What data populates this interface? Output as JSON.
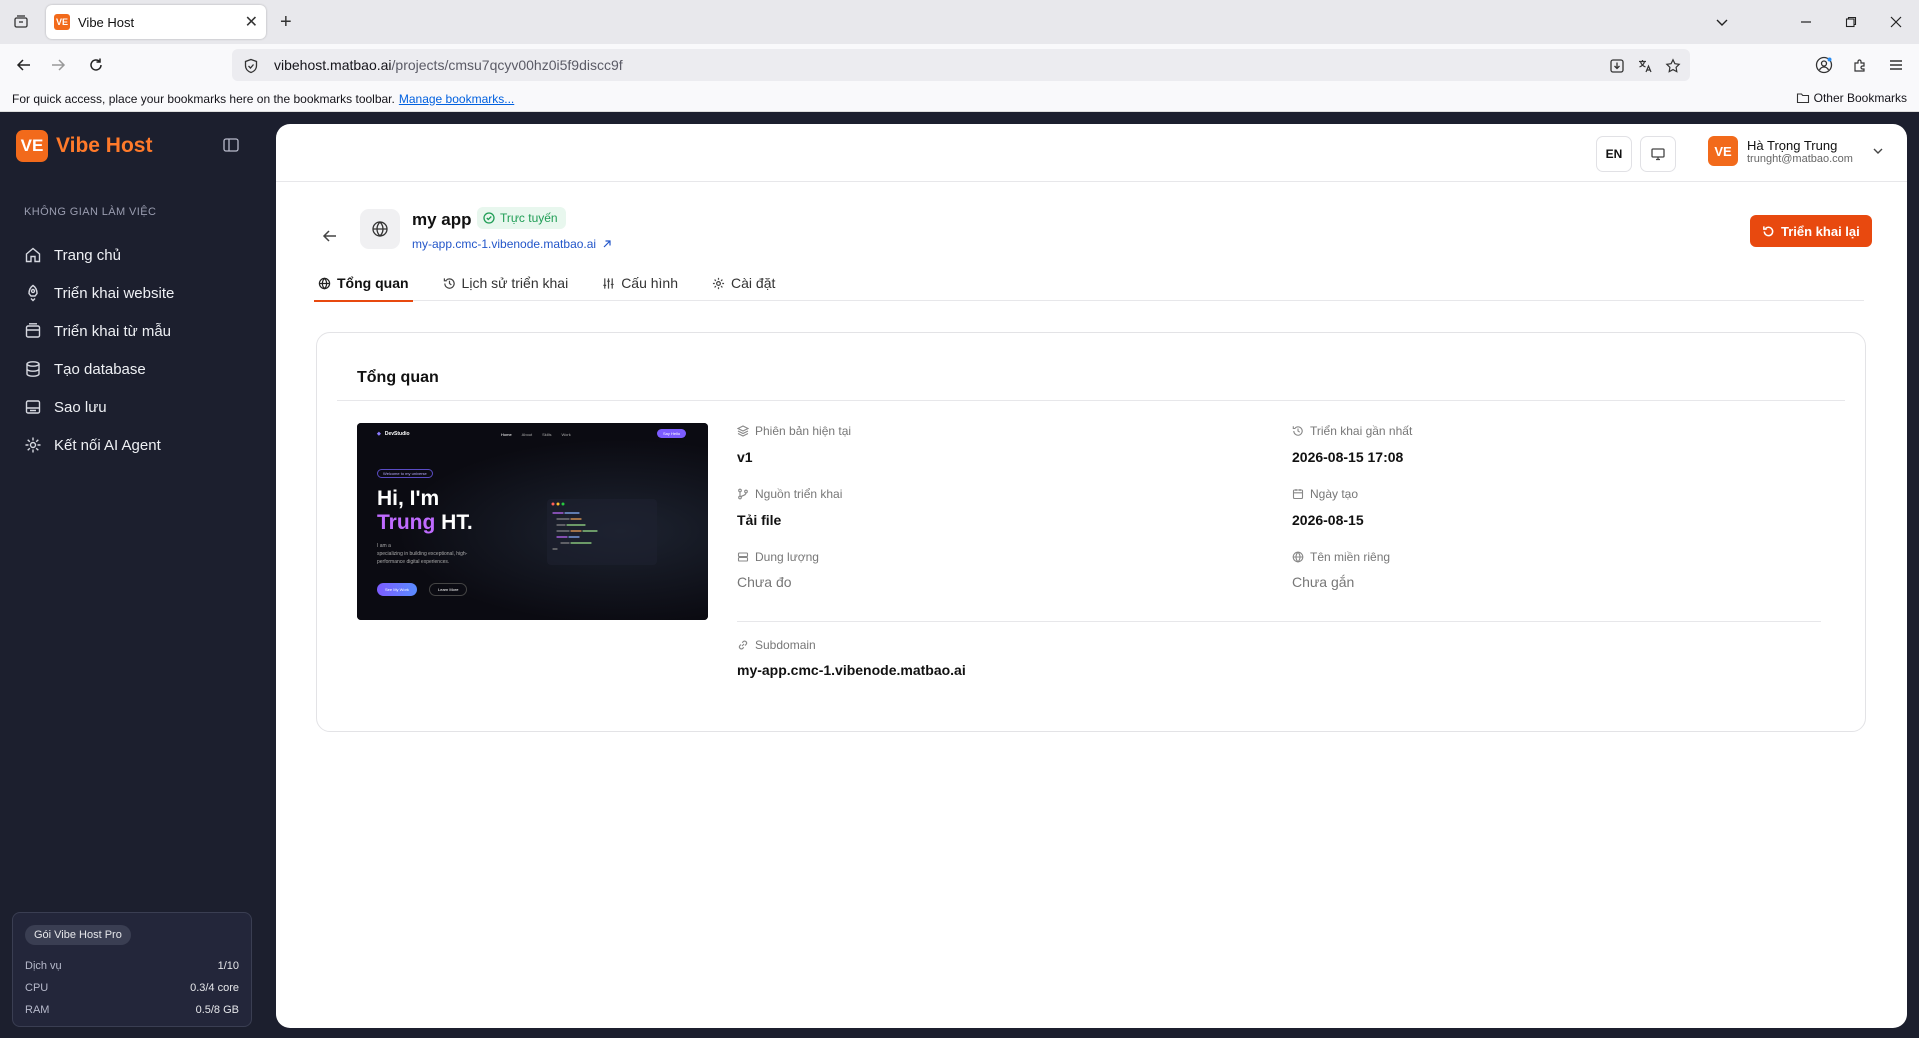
{
  "browser": {
    "tab_title": "Vibe Host",
    "url_host": "vibehost.matbao.ai",
    "url_path": "/projects/cmsu7qcyv00hz0i5f9discc9f",
    "bookmarks_hint": "For quick access, place your bookmarks here on the bookmarks toolbar.",
    "manage_bookmarks": "Manage bookmarks...",
    "other_bookmarks": "Other Bookmarks"
  },
  "sidebar": {
    "logo_mark": "VE",
    "brand": "Vibe Host",
    "section_label": "KHÔNG GIAN LÀM VIỆC",
    "items": [
      {
        "label": "Trang chủ",
        "icon": "home-icon"
      },
      {
        "label": "Triển khai website",
        "icon": "rocket-icon"
      },
      {
        "label": "Triển khai từ mẫu",
        "icon": "template-icon"
      },
      {
        "label": "Tạo database",
        "icon": "database-icon"
      },
      {
        "label": "Sao lưu",
        "icon": "backup-icon"
      },
      {
        "label": "Kết nối AI Agent",
        "icon": "ai-agent-icon"
      }
    ],
    "plan": {
      "badge": "Gói Vibe Host Pro",
      "rows": [
        {
          "label": "Dịch vụ",
          "value": "1/10"
        },
        {
          "label": "CPU",
          "value": "0.3/4 core"
        },
        {
          "label": "RAM",
          "value": "0.5/8 GB"
        }
      ]
    }
  },
  "topbar": {
    "lang": "EN",
    "user_initials": "VE",
    "user_name": "Hà Trọng Trung",
    "user_email": "trunght@matbao.com"
  },
  "project": {
    "name": "my app",
    "status": "Trực tuyến",
    "link": "my-app.cmc-1.vibenode.matbao.ai",
    "redeploy": "Triển khai lại",
    "tabs": [
      {
        "label": "Tổng quan",
        "icon": "globe-icon",
        "active": true
      },
      {
        "label": "Lịch sử triển khai",
        "icon": "history-icon",
        "active": false
      },
      {
        "label": "Cấu hình",
        "icon": "sliders-icon",
        "active": false
      },
      {
        "label": "Cài đặt",
        "icon": "gear-icon",
        "active": false
      }
    ]
  },
  "overview": {
    "title": "Tổng quan",
    "preview": {
      "brand": "DevStudio",
      "nav": [
        "Home",
        "About",
        "Skills",
        "Work"
      ],
      "cta": "Say Hello",
      "badge": "Welcome to my universe",
      "headline1": "Hi, I'm",
      "headline2a": "Trung",
      "headline2b": "HT.",
      "sub1": "I am a",
      "sub2": "specializing in building exceptional, high-",
      "sub3": "performance digital experiences.",
      "btn1": "See My Work",
      "btn2": "Learn More"
    },
    "version_label": "Phiên bản hiện tại",
    "version_value": "v1",
    "last_deploy_label": "Triển khai gần nhất",
    "last_deploy_value": "2026-08-15 17:08",
    "source_label": "Nguồn triển khai",
    "source_value": "Tải file",
    "created_label": "Ngày tạo",
    "created_value": "2026-08-15",
    "storage_label": "Dung lượng",
    "storage_value": "Chưa đo",
    "domain_label": "Tên miền riêng",
    "domain_value": "Chưa gắn",
    "subdomain_label": "Subdomain",
    "subdomain_value": "my-app.cmc-1.vibenode.matbao.ai"
  },
  "colors": {
    "accent": "#e8490f",
    "brand": "#f26a1b",
    "sidebar_bg": "#1c1f2e",
    "status_green": "#1f9d55",
    "link": "#2356c9"
  }
}
